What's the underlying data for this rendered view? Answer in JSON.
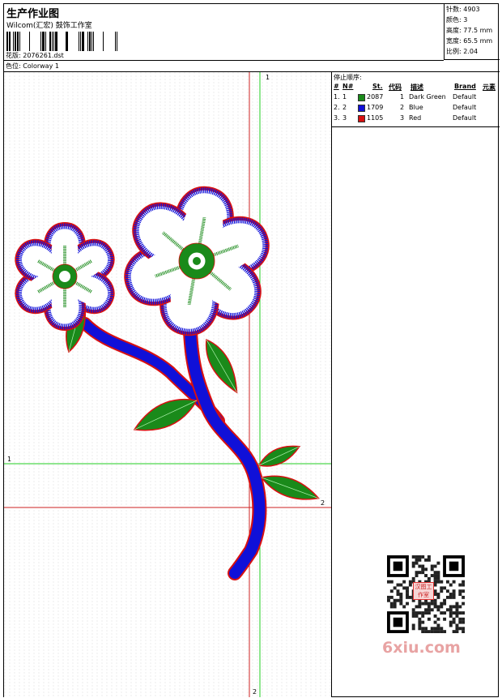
{
  "header": {
    "title": "生产作业图",
    "company": "Wilcom(汇宏) 鼓饰工作室",
    "design_label": "花版:",
    "design_value": "2076261.dst",
    "colorway_label": "色位:",
    "colorway_value": "Colorway 1"
  },
  "stats": [
    {
      "label": "针数:",
      "value": "4903"
    },
    {
      "label": "颜色:",
      "value": "3"
    },
    {
      "label": "高度:",
      "value": "77.5 mm"
    },
    {
      "label": "宽度:",
      "value": "65.5 mm"
    },
    {
      "label": "比例:",
      "value": "2.04"
    }
  ],
  "panel": {
    "title": "停止顺序:",
    "columns": [
      "#",
      "N#",
      "St.",
      "代码",
      "描述",
      "Brand",
      "元素"
    ],
    "rows": [
      {
        "num": "1.",
        "n": "1",
        "color": "#1a8a1a",
        "st": "2087",
        "code": "1",
        "desc": "Dark Green",
        "brand": "Default"
      },
      {
        "num": "2.",
        "n": "2",
        "color": "#1010d8",
        "st": "1709",
        "code": "2",
        "desc": "Blue",
        "brand": "Default"
      },
      {
        "num": "3.",
        "n": "3",
        "color": "#d81010",
        "st": "1105",
        "code": "3",
        "desc": "Red",
        "brand": "Default"
      }
    ]
  },
  "crosshair_labels": {
    "top_green": "1",
    "left_green": "1",
    "right_red": "2",
    "bottom_red": "2"
  },
  "watermark": {
    "text": "6xiu.com",
    "stamp": "汉图工作室"
  },
  "colors": {
    "green": "#1a8a1a",
    "blue": "#1010d8",
    "red": "#d81010",
    "guide_green": "#22cc22",
    "guide_red": "#cc2222"
  }
}
